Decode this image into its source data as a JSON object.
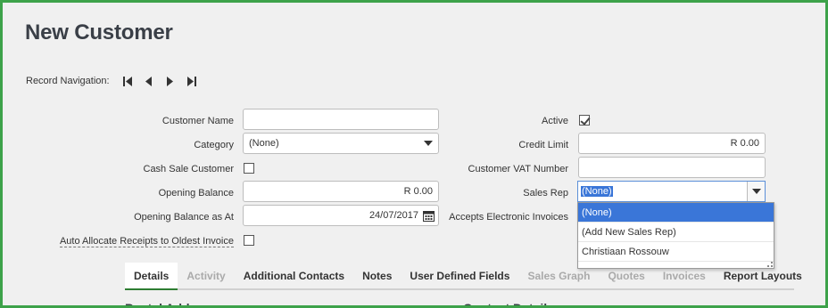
{
  "page": {
    "title": "New Customer"
  },
  "record_navigation": {
    "label": "Record Navigation:"
  },
  "form_left": {
    "customer_name_label": "Customer Name",
    "customer_name_value": "",
    "category_label": "Category",
    "category_value": "(None)",
    "cash_sale_label": "Cash Sale Customer",
    "cash_sale_checked": false,
    "opening_balance_label": "Opening Balance",
    "opening_balance_value": "R 0.00",
    "opening_balance_as_at_label": "Opening Balance as At",
    "opening_balance_as_at_value": "24/07/2017",
    "auto_allocate_label": "Auto Allocate Receipts to Oldest Invoice",
    "auto_allocate_checked": false
  },
  "form_right": {
    "active_label": "Active",
    "active_checked": true,
    "credit_limit_label": "Credit Limit",
    "credit_limit_value": "R 0.00",
    "vat_number_label": "Customer VAT Number",
    "vat_number_value": "",
    "sales_rep_label": "Sales Rep",
    "sales_rep_value": "(None)",
    "accepts_electronic_label": "Accepts Electronic Invoices"
  },
  "sales_rep_options": [
    "(None)",
    "(Add New Sales Rep)",
    "Christiaan Rossouw"
  ],
  "tabs": [
    {
      "label": "Details",
      "state": "active"
    },
    {
      "label": "Activity",
      "state": "disabled"
    },
    {
      "label": "Additional Contacts",
      "state": "normal"
    },
    {
      "label": "Notes",
      "state": "normal"
    },
    {
      "label": "User Defined Fields",
      "state": "normal"
    },
    {
      "label": "Sales Graph",
      "state": "disabled"
    },
    {
      "label": "Quotes",
      "state": "disabled"
    },
    {
      "label": "Invoices",
      "state": "disabled"
    },
    {
      "label": "Report Layouts",
      "state": "normal"
    }
  ],
  "sections": {
    "postal_address": "Postal Address",
    "contact_details": "Contact Details"
  },
  "colors": {
    "frame_border": "#3da24a",
    "highlight": "#3a76d8",
    "tab_active_underline": "#2e7d32"
  }
}
